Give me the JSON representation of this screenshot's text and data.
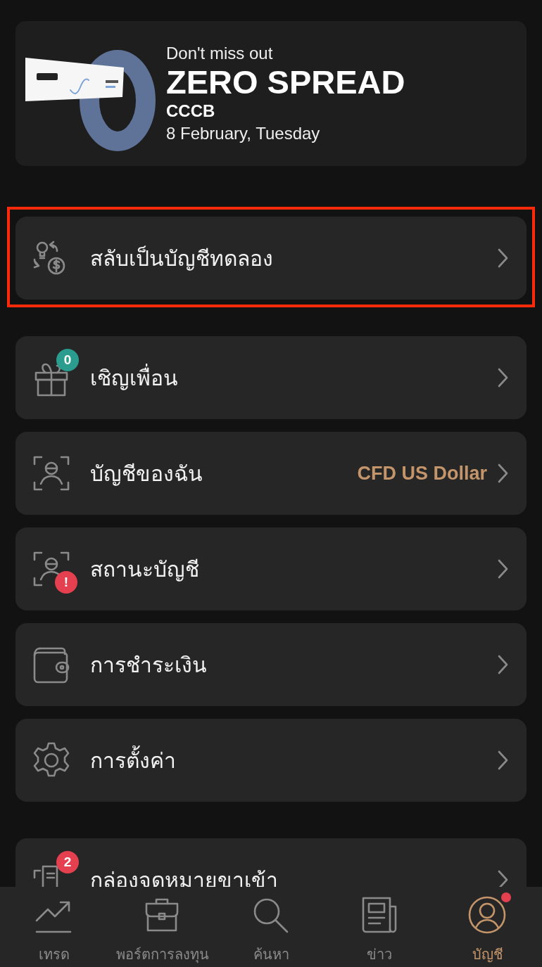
{
  "banner": {
    "kind": "picture",
    "subtitle": "Don't miss out",
    "title": "ZERO SPREAD",
    "symbol": "CCCB",
    "date": "8 February, Tuesday"
  },
  "menu": [
    {
      "kind": "switch",
      "label": "สลับเป็นบัญชีทดลอง",
      "highlighted": true
    },
    {
      "kind": "gift",
      "label": "เชิญเพื่อน",
      "highlighted": false,
      "badge": "0",
      "color": "#2a9d8f"
    },
    {
      "kind": "profile",
      "label": "บัญชีของฉัน",
      "highlighted": false,
      "value": "CFD US Dollar"
    },
    {
      "kind": "profile",
      "label": "สถานะบัญชี",
      "highlighted": false,
      "badge": "!",
      "color": "#e5404f"
    },
    {
      "kind": "wallet",
      "label": "การชำระเงิน",
      "highlighted": false
    },
    {
      "kind": "gear",
      "label": "การตั้งค่า",
      "highlighted": false
    },
    {
      "kind": "inbox",
      "label": "กล่องจดหมายขาเข้า",
      "highlighted": false,
      "badge": "2",
      "color": "#e5404f"
    }
  ],
  "nav": [
    {
      "kind": "chart",
      "label": "เทรด",
      "selected": false,
      "notification": false
    },
    {
      "kind": "briefcase",
      "label": "พอร์ตการลงทุน",
      "selected": false,
      "notification": false
    },
    {
      "kind": "search",
      "label": "ค้นหา",
      "selected": false,
      "notification": false
    },
    {
      "kind": "news",
      "label": "ข่าว",
      "selected": false,
      "notification": false
    },
    {
      "kind": "user",
      "label": "บัญชี",
      "selected": true,
      "notification": true
    }
  ]
}
